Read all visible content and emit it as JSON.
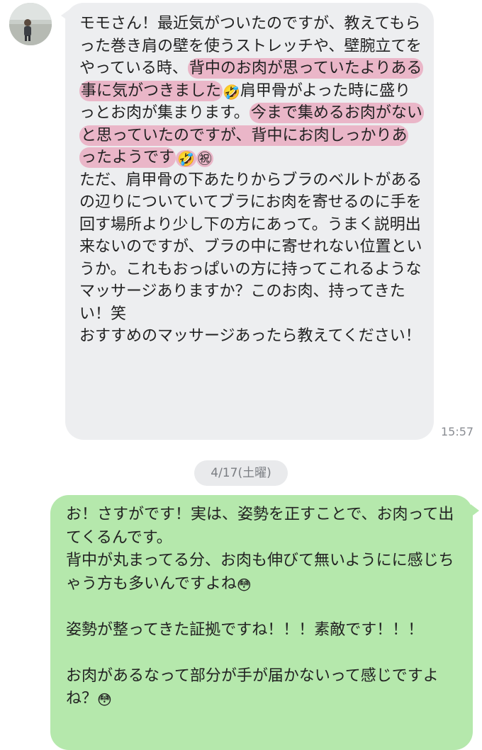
{
  "incoming": {
    "segments": [
      {
        "text": "モモさん！最近気がついたのですが、教えてもらった巻き肩の壁を使うストレッチや、壁腕立てをやっている時、",
        "highlight": false
      },
      {
        "text": "背中のお肉が思っていたよりある事に気がつきました",
        "highlight": true
      },
      {
        "emoji": "🤣",
        "highlight": false
      },
      {
        "text": "肩甲骨がよった時に盛りっとお肉が集まります。",
        "highlight": false
      },
      {
        "text": "今まで集めるお肉がないと思っていたのですが、背中にお肉しっかりあったようです",
        "highlight": true
      },
      {
        "emoji": "🤣",
        "highlight": true
      },
      {
        "emoji": "㊗",
        "highlight": true
      },
      {
        "text": "\nただ、肩甲骨の下あたりからブラのベルトがあるの辺りについていてブラにお肉を寄せるのに手を回す場所より少し下の方にあって。うまく説明出来ないのですが、ブラの中に寄せれない位置というか。これもおっぱいの方に持ってこれるようなマッサージありますか？このお肉、持ってきたい！笑\nおすすめのマッサージあったら教えてください！",
        "highlight": false
      }
    ],
    "time": "15:57"
  },
  "date_divider": "4/17(土曜)",
  "outgoing": {
    "segments": [
      {
        "text": "お！さすがです！実は、姿勢を正すことで、お肉って出てくるんです。\n背中が丸まってる分、お肉も伸びて無いようにに感じちゃう方も多いんですよね"
      },
      {
        "emoji": "😳"
      },
      {
        "text": "\n\n姿勢が整ってきた証拠ですね！！！素敵です！！！\n\nお肉があるなって部分が手が届かないって感じですよね？"
      },
      {
        "emoji": "😳"
      }
    ]
  }
}
